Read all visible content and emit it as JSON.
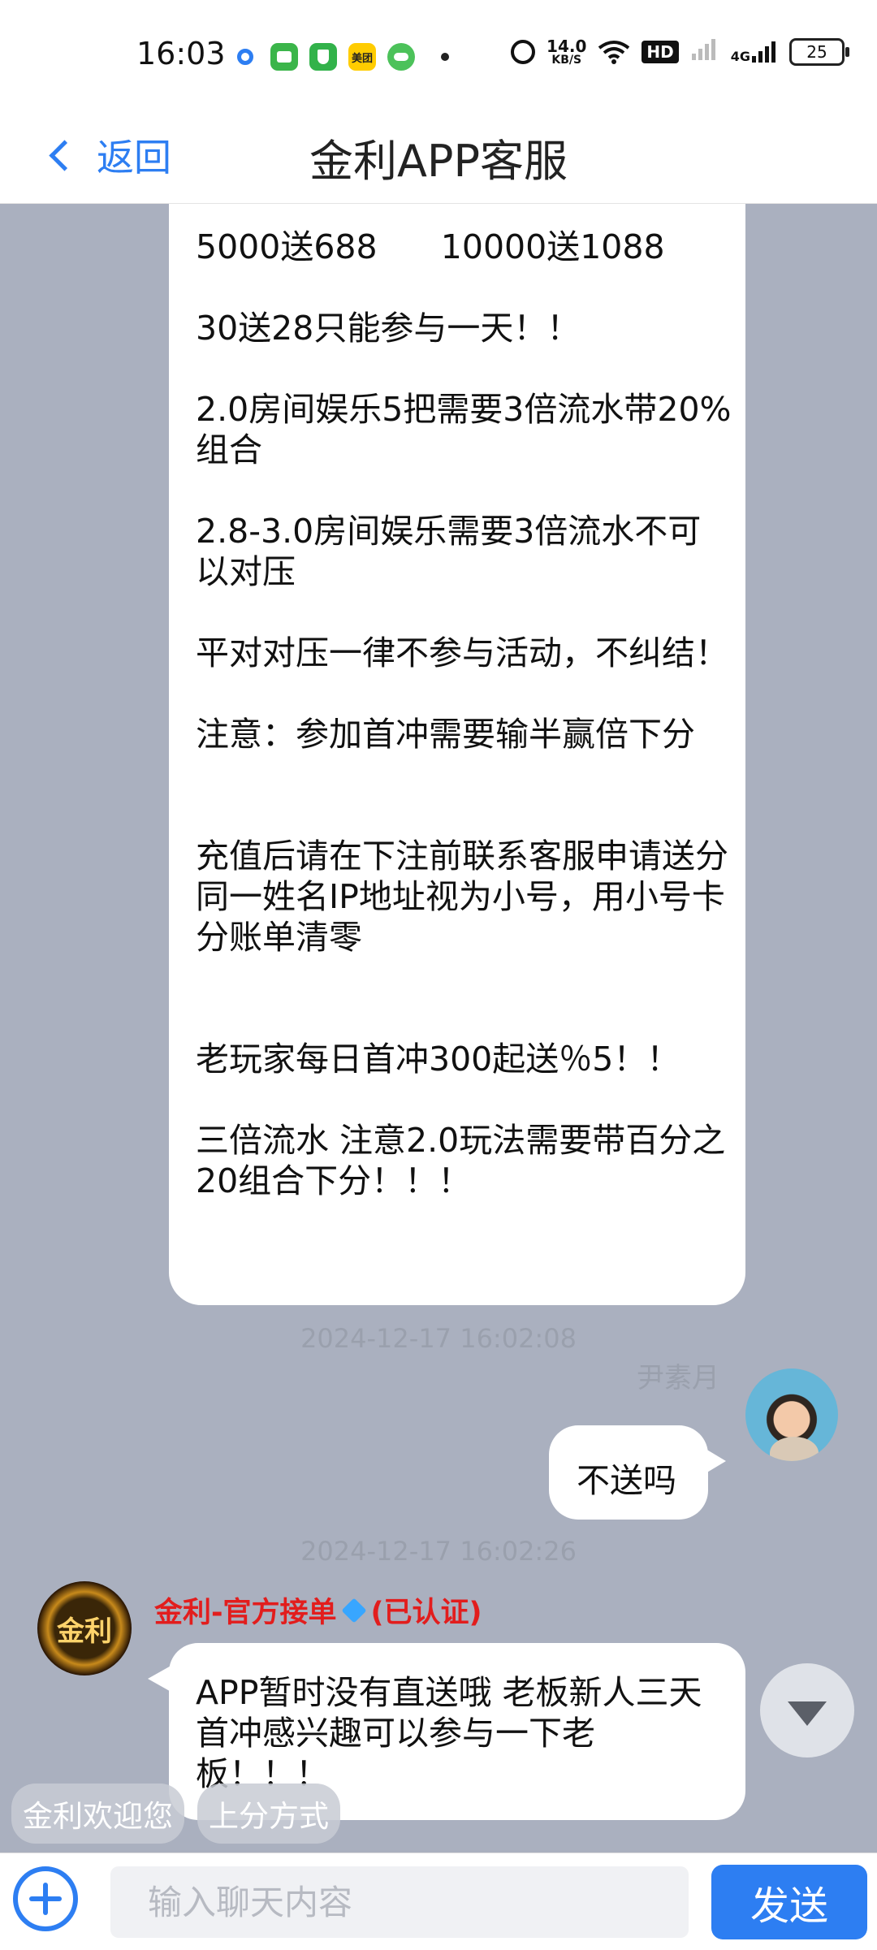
{
  "status_bar": {
    "time": "16:03",
    "app_icons": [
      "location-icon",
      "messages-icon",
      "shield-icon",
      "meituan-icon",
      "chat-app-icon"
    ],
    "meituan_label": "美团",
    "speed_value": "14.0",
    "speed_unit": "KB/S",
    "hd_label": "HD",
    "network_label": "4G",
    "battery": "25"
  },
  "header": {
    "back_label": "返回",
    "title": "金利APP客服"
  },
  "messages": [
    {
      "type": "incoming",
      "text": "5000送688      10000送1088\n\n30送28只能参与一天！！\n\n2.0房间娱乐5把需要3倍流水带20%组合\n\n2.8-3.0房间娱乐需要3倍流水不可以对压\n\n平对对压一律不参与活动，不纠结！\n\n注意：参加首冲需要输半赢倍下分\n\n\n充值后请在下注前联系客服申请送分同一姓名IP地址视为小号，用小号卡分账单清零\n\n\n老玩家每日首冲300起送％5！！\n\n三倍流水 注意2.0玩法需要带百分之20组合下分！！！"
    },
    {
      "type": "timestamp",
      "text": "2024-12-17 16:02:08"
    },
    {
      "type": "outgoing",
      "sender": "尹素月",
      "text": "不送吗"
    },
    {
      "type": "timestamp",
      "text": "2024-12-17 16:02:26"
    },
    {
      "type": "incoming",
      "sender": "金利-官方接单",
      "verified_label": "(已认证)",
      "avatar_text": "金利",
      "text": "APP暂时没有直送哦 老板新人三天首冲感兴趣可以参与一下老板！！！"
    }
  ],
  "quick_replies": [
    "金利欢迎您",
    "上分方式"
  ],
  "input": {
    "placeholder": "输入聊天内容",
    "send_label": "发送"
  },
  "colors": {
    "accent": "#2d7ef2",
    "chat_background": "#aab0bf",
    "sender_name": "#e21d1d"
  }
}
